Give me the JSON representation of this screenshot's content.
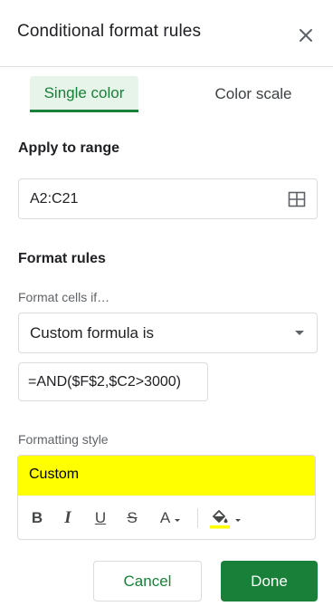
{
  "panel": {
    "title": "Conditional format rules"
  },
  "tabs": [
    {
      "label": "Single color",
      "active": true
    },
    {
      "label": "Color scale",
      "active": false
    }
  ],
  "apply_to_range": {
    "label": "Apply to range",
    "value": "A2:C21"
  },
  "format_rules": {
    "label": "Format rules",
    "condition_label": "Format cells if…",
    "condition_value": "Custom formula is",
    "formula_value": "=AND($F$2,$C2>3000)"
  },
  "formatting_style": {
    "label": "Formatting style",
    "preview_text": "Custom",
    "preview_background": "#ffff00",
    "toolbar": {
      "bold": "B",
      "italic": "I",
      "underline": "U",
      "strikethrough": "S",
      "text_color": "A"
    }
  },
  "actions": {
    "cancel_label": "Cancel",
    "done_label": "Done"
  },
  "colors": {
    "accent_green": "#188038",
    "tab_highlight": "#e6f4ea",
    "fill_indicator": "#ffff00"
  }
}
